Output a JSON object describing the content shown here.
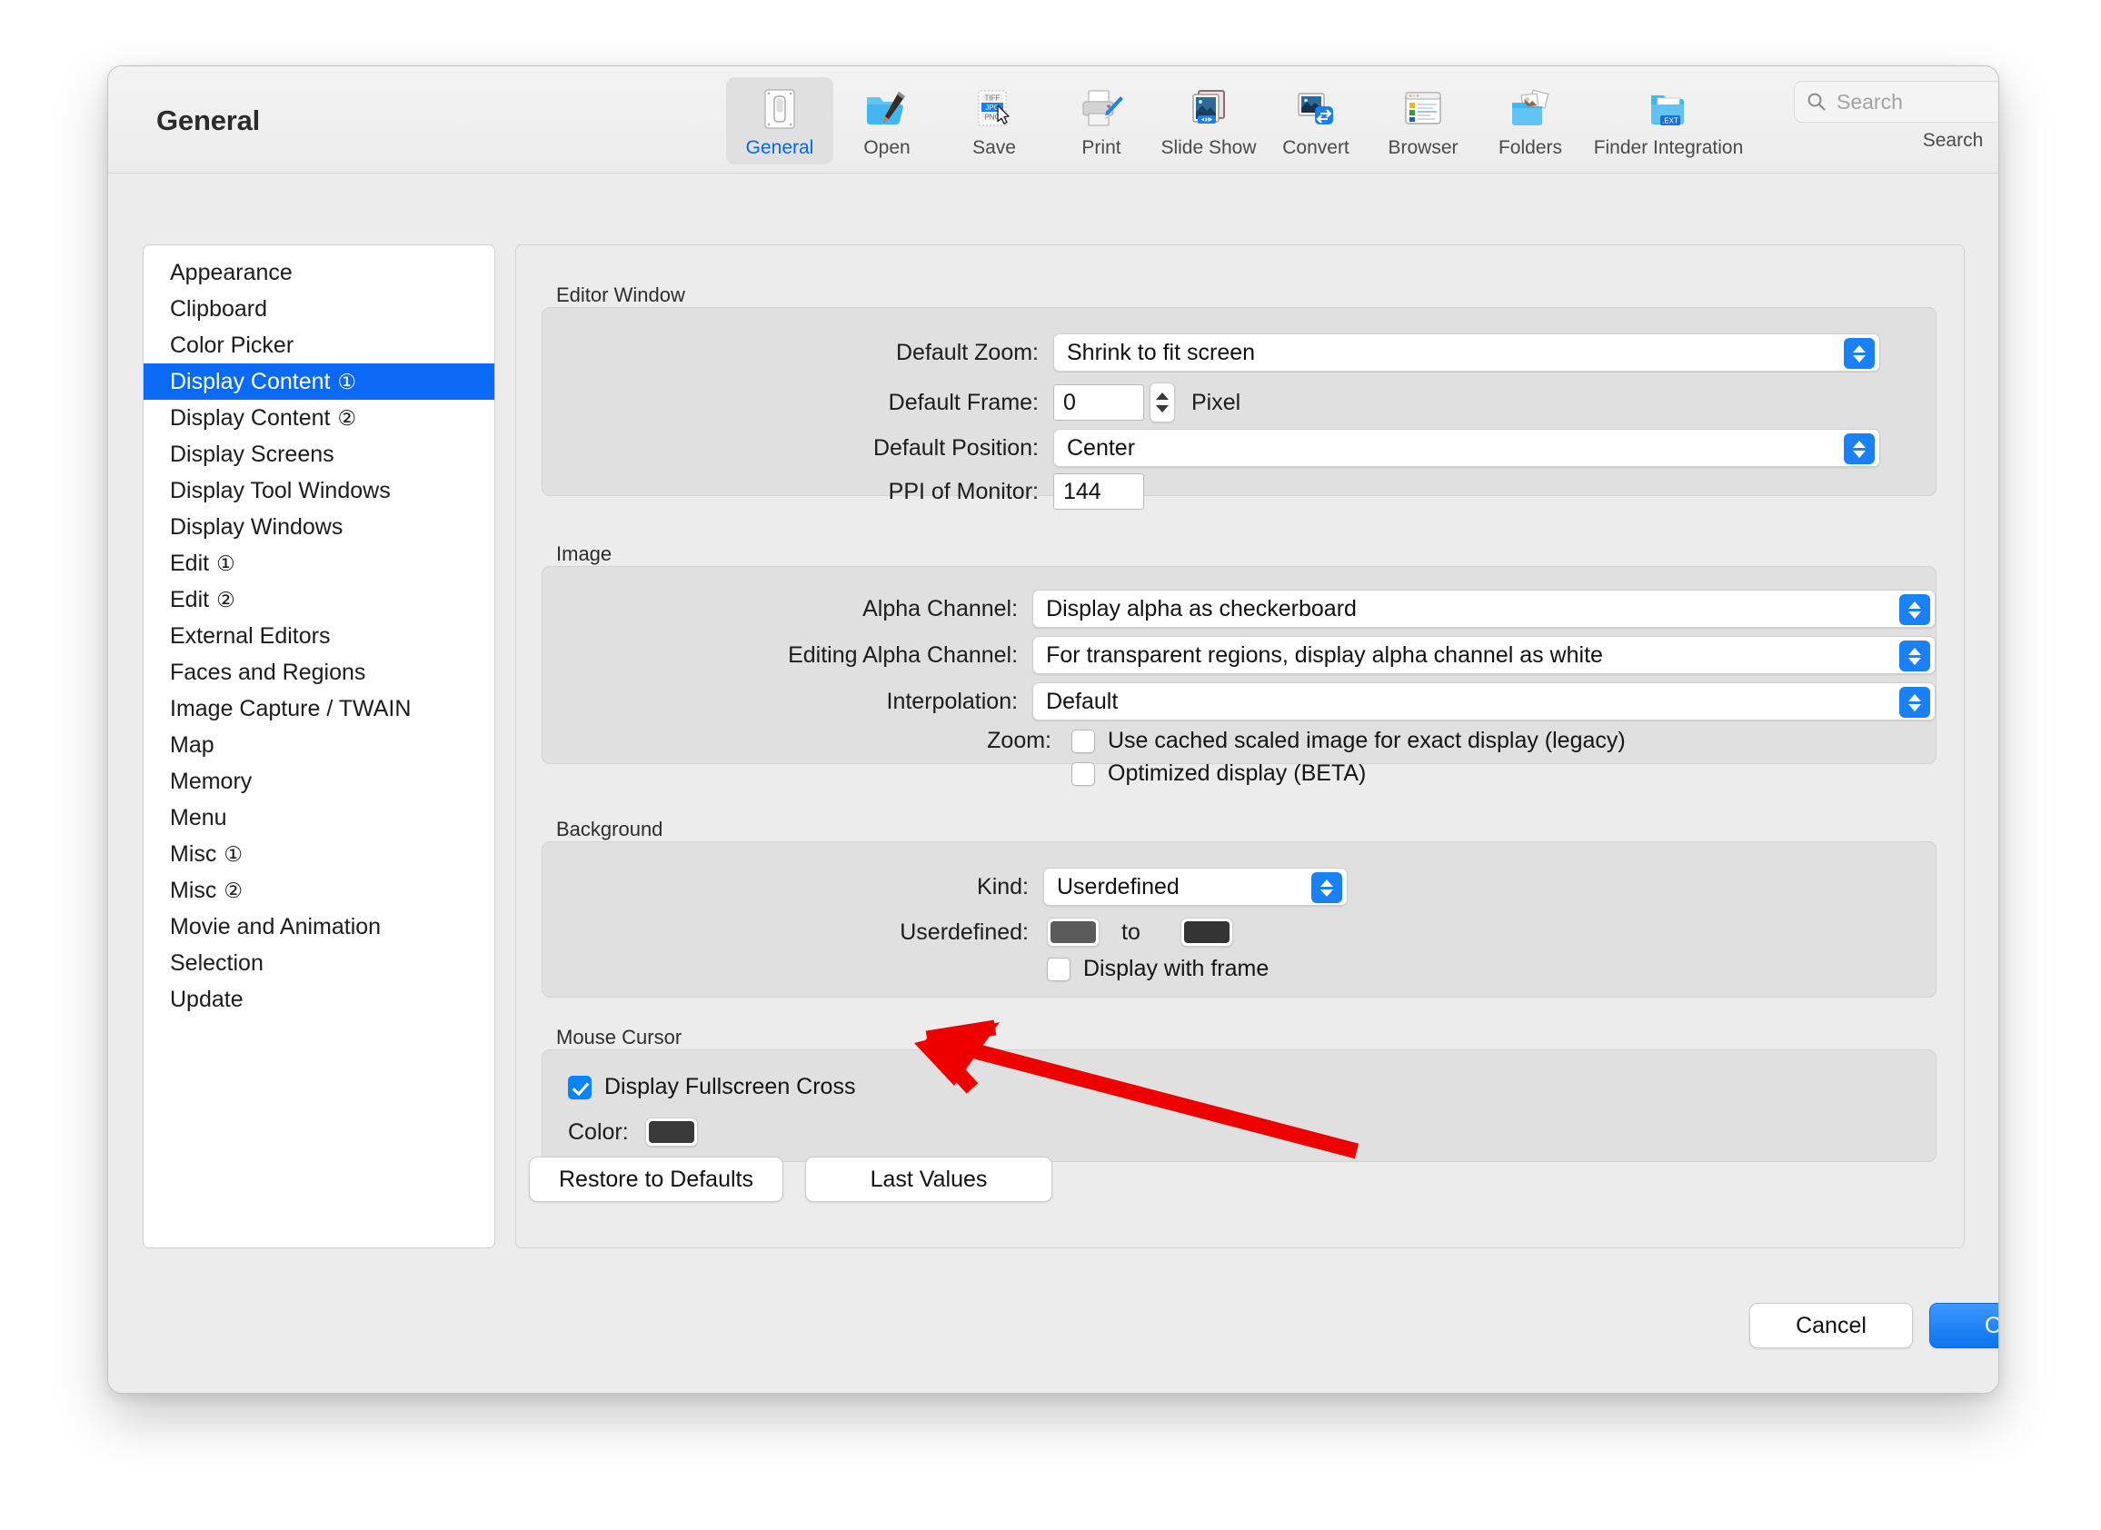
{
  "window": {
    "title": "General"
  },
  "toolbar": {
    "items": [
      {
        "label": "General",
        "icon": "switch-icon",
        "selected": true
      },
      {
        "label": "Open",
        "icon": "folder-brush-icon",
        "selected": false
      },
      {
        "label": "Save",
        "icon": "file-formats-icon",
        "selected": false
      },
      {
        "label": "Print",
        "icon": "printer-icon",
        "selected": false
      },
      {
        "label": "Slide Show",
        "icon": "slideshow-icon",
        "selected": false
      },
      {
        "label": "Convert",
        "icon": "convert-icon",
        "selected": false
      },
      {
        "label": "Browser",
        "icon": "browser-window-icon",
        "selected": false
      },
      {
        "label": "Folders",
        "icon": "folder-photos-icon",
        "selected": false
      },
      {
        "label": "Finder Integration",
        "icon": "folder-ext-icon",
        "selected": false
      }
    ],
    "search": {
      "placeholder": "Search",
      "value": "",
      "caption": "Search",
      "icon": "search-icon"
    }
  },
  "sidebar": {
    "items": [
      {
        "label": "Appearance",
        "badge": "",
        "active": false
      },
      {
        "label": "Clipboard",
        "badge": "",
        "active": false
      },
      {
        "label": "Color Picker",
        "badge": "",
        "active": false
      },
      {
        "label": "Display Content",
        "badge": "①",
        "active": true
      },
      {
        "label": "Display Content",
        "badge": "②",
        "active": false
      },
      {
        "label": "Display Screens",
        "badge": "",
        "active": false
      },
      {
        "label": "Display Tool Windows",
        "badge": "",
        "active": false
      },
      {
        "label": "Display Windows",
        "badge": "",
        "active": false
      },
      {
        "label": "Edit",
        "badge": "①",
        "active": false
      },
      {
        "label": "Edit",
        "badge": "②",
        "active": false
      },
      {
        "label": "External Editors",
        "badge": "",
        "active": false
      },
      {
        "label": "Faces and Regions",
        "badge": "",
        "active": false
      },
      {
        "label": "Image Capture / TWAIN",
        "badge": "",
        "active": false
      },
      {
        "label": "Map",
        "badge": "",
        "active": false
      },
      {
        "label": "Memory",
        "badge": "",
        "active": false
      },
      {
        "label": "Menu",
        "badge": "",
        "active": false
      },
      {
        "label": "Misc",
        "badge": "①",
        "active": false
      },
      {
        "label": "Misc",
        "badge": "②",
        "active": false
      },
      {
        "label": "Movie and Animation",
        "badge": "",
        "active": false
      },
      {
        "label": "Selection",
        "badge": "",
        "active": false
      },
      {
        "label": "Update",
        "badge": "",
        "active": false
      }
    ]
  },
  "editor_window": {
    "title": "Editor Window",
    "default_zoom_label": "Default Zoom:",
    "default_zoom_value": "Shrink to fit screen",
    "default_frame_label": "Default Frame:",
    "default_frame_value": "0",
    "default_frame_unit": "Pixel",
    "default_position_label": "Default Position:",
    "default_position_value": "Center",
    "ppi_label": "PPI of Monitor:",
    "ppi_value": "144"
  },
  "image": {
    "title": "Image",
    "alpha_channel_label": "Alpha Channel:",
    "alpha_channel_value": "Display alpha as checkerboard",
    "editing_alpha_label": "Editing Alpha Channel:",
    "editing_alpha_value": "For transparent regions, display alpha channel as white",
    "interpolation_label": "Interpolation:",
    "interpolation_value": "Default",
    "zoom_label": "Zoom:",
    "cached_checkbox": "Use cached scaled image for exact display (legacy)",
    "cached_checked": false,
    "optimized_checkbox": "Optimized display (BETA)",
    "optimized_checked": false
  },
  "background": {
    "title": "Background",
    "kind_label": "Kind:",
    "kind_value": "Userdefined",
    "userdefined_label": "Userdefined:",
    "color_from": "#5a5a5a",
    "to_text": "to",
    "color_to": "#333333",
    "frame_checkbox": "Display with frame",
    "frame_checked": false
  },
  "mouse_cursor": {
    "title": "Mouse Cursor",
    "fullscreen_cross_checkbox": "Display Fullscreen Cross",
    "fullscreen_cross_checked": true,
    "color_label": "Color:",
    "color_value": "#3a3a3a"
  },
  "actions": {
    "restore_defaults": "Restore to Defaults",
    "last_values": "Last Values",
    "cancel": "Cancel",
    "ok": "OK"
  },
  "annotation": {
    "arrow_color": "#ee0000",
    "arrow_name": "red-pointer-arrow"
  }
}
